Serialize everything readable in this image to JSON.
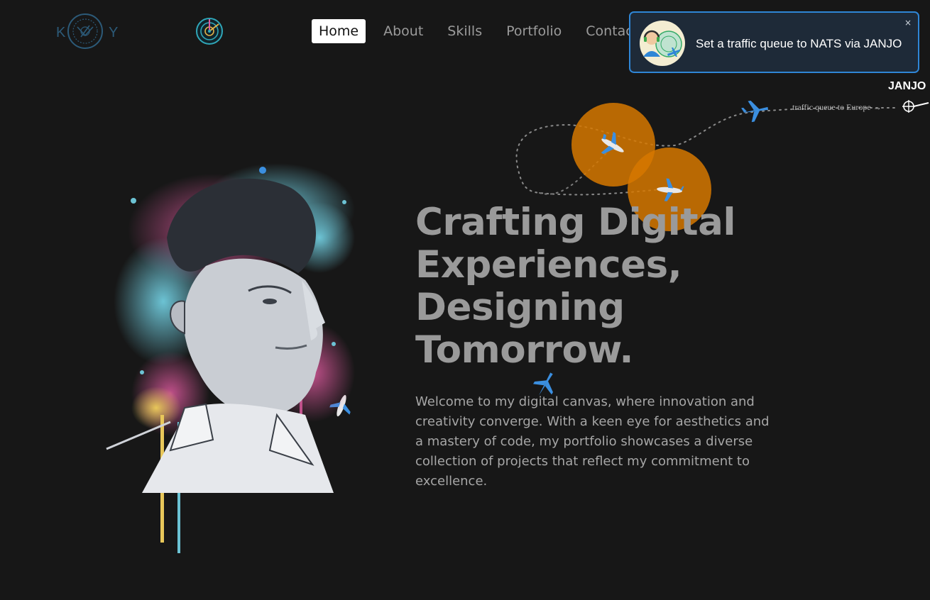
{
  "brand": {
    "left_letter": "K",
    "right_letter": "Y",
    "logo_icon": "monogram-seal-icon",
    "radar_icon": "radar-icon"
  },
  "nav": [
    {
      "label": "Home",
      "active": true
    },
    {
      "label": "About",
      "active": false
    },
    {
      "label": "Skills",
      "active": false
    },
    {
      "label": "Portfolio",
      "active": false
    },
    {
      "label": "Contact",
      "active": false
    }
  ],
  "toast": {
    "message": "Set a traffic queue to NATS via JANJO",
    "close": "×",
    "avatar_icon": "air-traffic-controller-icon"
  },
  "traffic": {
    "waypoint": "JANJO",
    "route_label": "traffic queue to Europe →",
    "target_icon": "crosshair-icon"
  },
  "hero": {
    "title_lines": [
      "Crafting Digital",
      "Experiences,",
      "Designing",
      "Tomorrow."
    ],
    "text": "Welcome to my digital canvas, where innovation and creativity converge. With a keen eye for aesthetics and a mastery of code, my portfolio showcases a diverse collection of projects that reflect my commitment to excellence.",
    "portrait_icon": "watercolor-portrait-illustration"
  },
  "colors": {
    "background": "#171717",
    "accent_blue": "#2f86d6",
    "ring_orange": "#d67800",
    "plane_blue": "#3b8fe0"
  }
}
